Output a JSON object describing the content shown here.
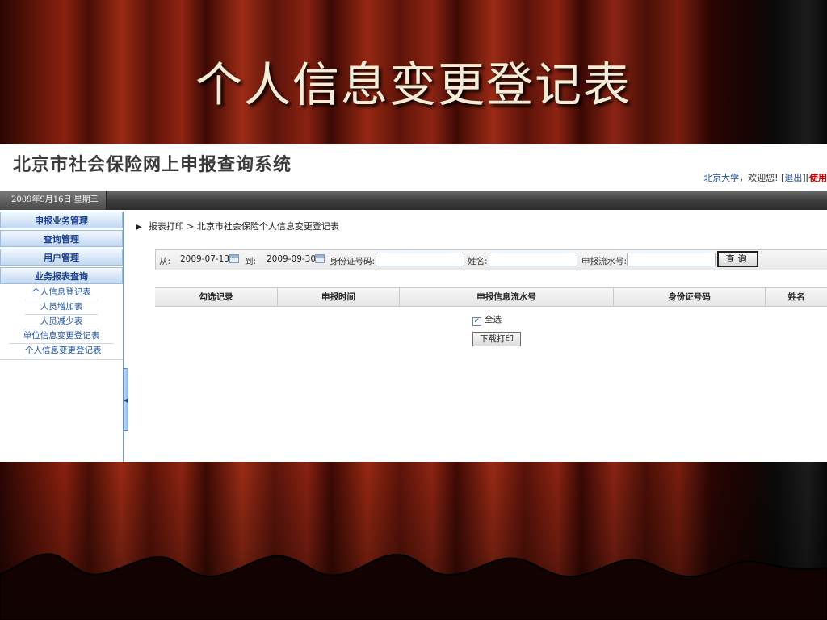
{
  "slide": {
    "title": "个人信息变更登记表"
  },
  "app": {
    "system_title": "北京市社会保险网上申报查询系统",
    "welcome": {
      "user": "北京大学",
      "greeting": "，欢迎您!",
      "bracket_open": "[",
      "logout": "退出",
      "bracket_mid": "][",
      "help": "使用"
    },
    "date": "2009年9月16日 星期三"
  },
  "sidebar": {
    "menus": [
      {
        "label": "申报业务管理"
      },
      {
        "label": "查询管理"
      },
      {
        "label": "用户管理"
      },
      {
        "label": "业务报表查询"
      }
    ],
    "sub_items": [
      {
        "label": "个人信息登记表"
      },
      {
        "label": "人员增加表"
      },
      {
        "label": "人员减少表"
      },
      {
        "label": "单位信息变更登记表"
      },
      {
        "label": "个人信息变更登记表"
      }
    ]
  },
  "breadcrumb": {
    "arrow": "▶",
    "path": "报表打印 > 北京市社会保险个人信息变更登记表"
  },
  "search": {
    "from_label": "从:",
    "from_value": "2009-07-13",
    "to_label": "到:",
    "to_value": "2009-09-30",
    "id_label": "身份证号码:",
    "id_value": "",
    "name_label": "姓名:",
    "name_value": "",
    "serial_label": "申报流水号:",
    "serial_value": "",
    "query_button": "查询"
  },
  "table": {
    "columns": [
      "勾选记录",
      "申报时间",
      "申报信息流水号",
      "身份证号码",
      "姓名"
    ]
  },
  "actions": {
    "select_all_label": "全选",
    "select_all_checked": true,
    "download_print": "下载打印"
  }
}
